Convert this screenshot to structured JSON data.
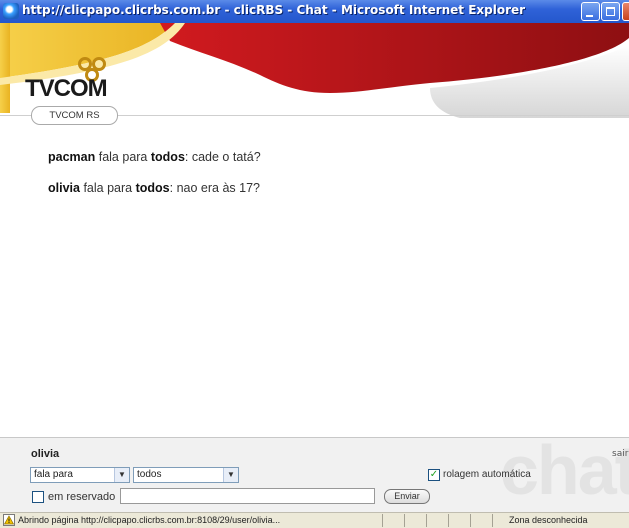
{
  "window": {
    "title": "http://clicpapo.clicrbs.com.br - clicRBS - Chat - Microsoft Internet Explorer"
  },
  "header": {
    "logo_text": "TVCOM",
    "tab_label": "TVCOM RS"
  },
  "messages": [
    {
      "sender": "pacman",
      "verb": "fala para",
      "target": "todos",
      "text": ": cade o tatá?"
    },
    {
      "sender": "olivia",
      "verb": "fala para",
      "target": "todos",
      "text": ": nao era às 17?"
    }
  ],
  "controls": {
    "username": "olivia",
    "sair_label": "sair",
    "action_select": "fala para",
    "recipient_select": "todos",
    "auto_scroll_label": "rolagem automática",
    "auto_scroll_checked": true,
    "reserved_label": "em reservado",
    "reserved_checked": false,
    "message_value": "",
    "send_label": "Enviar",
    "watermark": "chat"
  },
  "status": {
    "text": "Abrindo página http://clicpapo.clicrbs.com.br:8108/29/user/olivia...",
    "zone": "Zona desconhecida"
  },
  "colors": {
    "header_red": "#b3161a",
    "header_yellow": "#f2c233",
    "titlebar_blue": "#2457cc"
  }
}
